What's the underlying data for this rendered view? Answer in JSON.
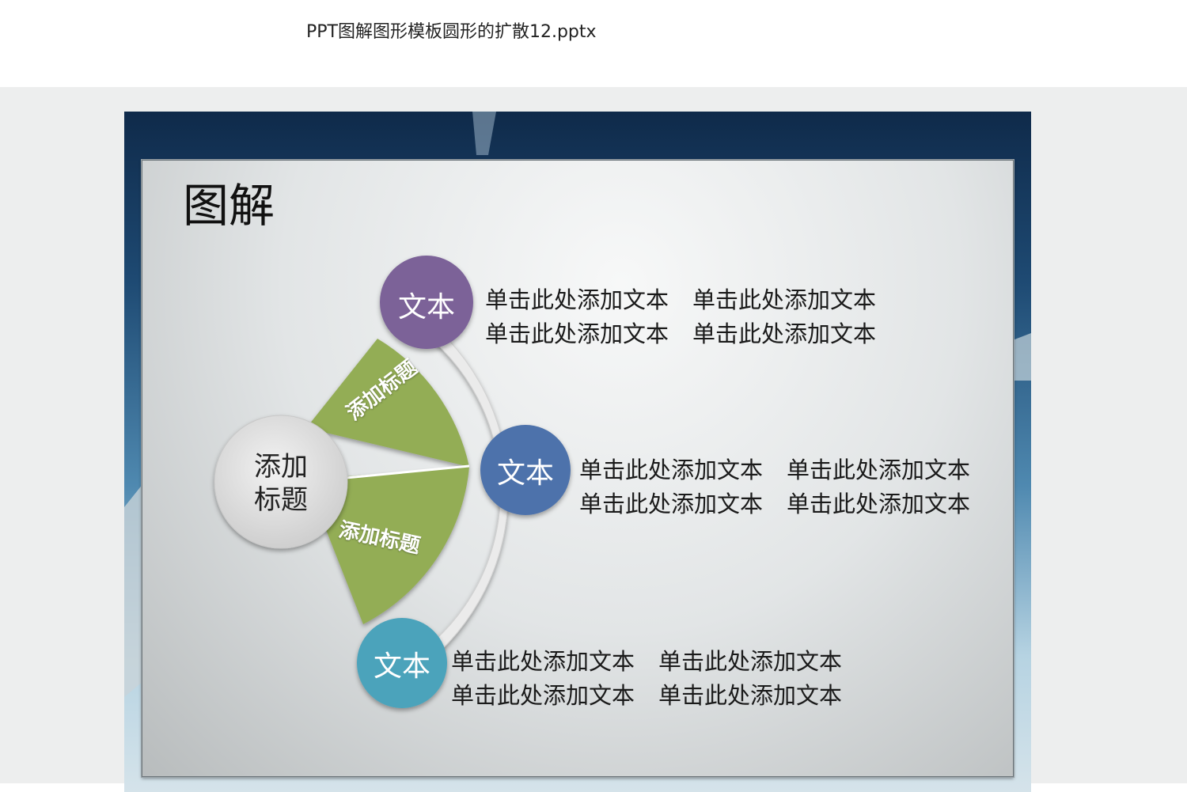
{
  "window": {
    "file_title": "PPT图解图形模板圆形的扩散12.pptx"
  },
  "slide": {
    "title": "图解",
    "center": {
      "line1": "添加",
      "line2": "标题"
    },
    "fan_labels": [
      "添加标题",
      "添加标题"
    ],
    "nodes": [
      {
        "label": "文本",
        "color": "#7b6298"
      },
      {
        "label": "文本",
        "color": "#4e72ab"
      },
      {
        "label": "文本",
        "color": "#4ba3bb"
      }
    ],
    "text_blocks": [
      {
        "rows": [
          [
            "单击此处添加文本",
            "单击此处添加文本"
          ],
          [
            "单击此处添加文本",
            "单击此处添加文本"
          ]
        ]
      },
      {
        "rows": [
          [
            "单击此处添加文本",
            "单击此处添加文本"
          ],
          [
            "单击此处添加文本",
            "单击此处添加文本"
          ]
        ]
      },
      {
        "rows": [
          [
            "单击此处添加文本",
            "单击此处添加文本"
          ],
          [
            "单击此处添加文本",
            "单击此处添加文本"
          ]
        ]
      }
    ],
    "colors": {
      "fan_green": "#93ad55",
      "center_gray": "#dcdcdc",
      "arc_gray": "#e8e8e8"
    }
  }
}
